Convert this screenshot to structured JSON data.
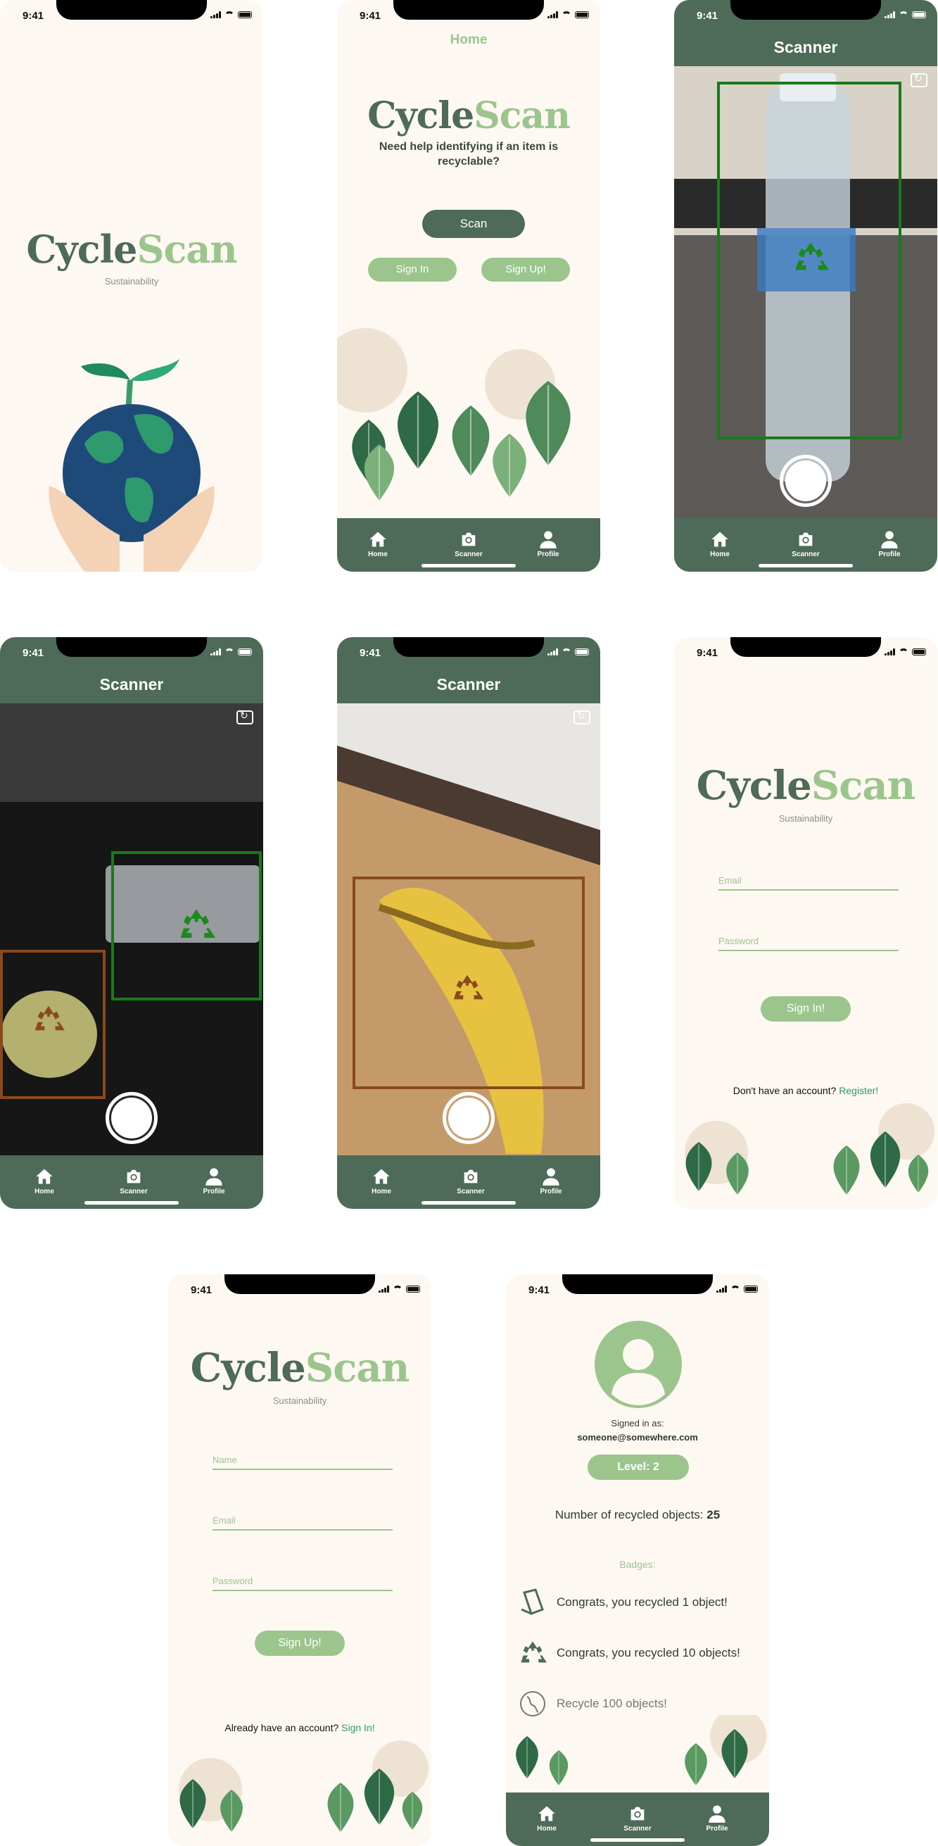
{
  "status": {
    "time": "9:41"
  },
  "brand": {
    "part1": "Cycle",
    "part2": "Scan",
    "tagline": "Sustainability"
  },
  "home": {
    "title": "Home",
    "question": "Need help identifying if an item is recyclable?",
    "scan_label": "Scan",
    "signin_label": "Sign In",
    "signup_label": "Sign Up!"
  },
  "scanner": {
    "title": "Scanner"
  },
  "tabs": {
    "home": "Home",
    "scanner": "Scanner",
    "profile": "Profile"
  },
  "signin": {
    "email_placeholder": "Email",
    "password_placeholder": "Password",
    "button": "Sign In!",
    "prompt": "Don't have an account?",
    "link": "Register!"
  },
  "signup": {
    "name_placeholder": "Name",
    "email_placeholder": "Email",
    "password_placeholder": "Password",
    "button": "Sign Up!",
    "prompt": "Already have an account?",
    "link": "Sign In!"
  },
  "profile": {
    "signed_in_as": "Signed in as:",
    "email": "someone@somewhere.com",
    "level": "Level: 2",
    "recycled_label": "Number of recycled objects:",
    "recycled_count": "25",
    "badges_title": "Badges:",
    "badges": [
      {
        "text": "Congrats, you recycled 1 object!",
        "icon": "bottle-icon"
      },
      {
        "text": "Congrats, you recycled 10 objects!",
        "icon": "recycle-icon"
      },
      {
        "text": "Recycle 100 objects!",
        "icon": "globe-icon"
      }
    ]
  },
  "colors": {
    "brand_dark": "#4e6a58",
    "brand_light": "#9cc58e",
    "background": "#fdf8f1",
    "recyclable_box": "#1a7a1a",
    "compost_box": "#8a4a1a"
  }
}
